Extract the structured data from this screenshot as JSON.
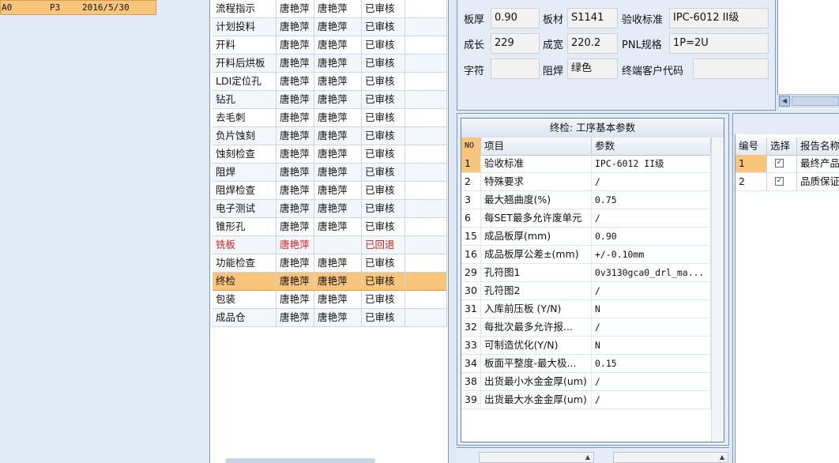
{
  "left_row": {
    "col0": "A0",
    "col1": "P3",
    "col2": "2016/5/30"
  },
  "process_rows": [
    {
      "name": "流程指示",
      "a": "唐艳萍",
      "b": "唐艳萍",
      "status": "已审核"
    },
    {
      "name": "计划投料",
      "a": "唐艳萍",
      "b": "唐艳萍",
      "status": "已审核"
    },
    {
      "name": "开料",
      "a": "唐艳萍",
      "b": "唐艳萍",
      "status": "已审核"
    },
    {
      "name": "开料后烘板",
      "a": "唐艳萍",
      "b": "唐艳萍",
      "status": "已审核"
    },
    {
      "name": "LDI定位孔",
      "a": "唐艳萍",
      "b": "唐艳萍",
      "status": "已审核"
    },
    {
      "name": "钻孔",
      "a": "唐艳萍",
      "b": "唐艳萍",
      "status": "已审核"
    },
    {
      "name": "去毛刺",
      "a": "唐艳萍",
      "b": "唐艳萍",
      "status": "已审核"
    },
    {
      "name": "负片蚀刻",
      "a": "唐艳萍",
      "b": "唐艳萍",
      "status": "已审核"
    },
    {
      "name": "蚀刻检查",
      "a": "唐艳萍",
      "b": "唐艳萍",
      "status": "已审核"
    },
    {
      "name": "阻焊",
      "a": "唐艳萍",
      "b": "唐艳萍",
      "status": "已审核"
    },
    {
      "name": "阻焊检查",
      "a": "唐艳萍",
      "b": "唐艳萍",
      "status": "已审核"
    },
    {
      "name": "电子测试",
      "a": "唐艳萍",
      "b": "唐艳萍",
      "status": "已审核"
    },
    {
      "name": "锥形孔",
      "a": "唐艳萍",
      "b": "唐艳萍",
      "status": "已审核"
    },
    {
      "name": "铣板",
      "a": "唐艳萍",
      "b": "",
      "status": "已回退",
      "highlight": "red"
    },
    {
      "name": "功能检查",
      "a": "唐艳萍",
      "b": "唐艳萍",
      "status": "已审核"
    },
    {
      "name": "终检",
      "a": "唐艳萍",
      "b": "唐艳萍",
      "status": "已审核",
      "selected": true
    },
    {
      "name": "包装",
      "a": "唐艳萍",
      "b": "唐艳萍",
      "status": "已审核"
    },
    {
      "name": "成品仓",
      "a": "唐艳萍",
      "b": "唐艳萍",
      "status": "已审核"
    }
  ],
  "info": {
    "thickness_label": "板厚",
    "thickness_value": "0.90",
    "material_label": "板材",
    "material_value": "S1141",
    "standard_label": "验收标准",
    "standard_value": "IPC-6012 II级",
    "length_label": "成长",
    "length_value": "229",
    "width_label": "成宽",
    "width_value": "220.2",
    "pnl_label": "PNL规格",
    "pnl_value": "1P=2U",
    "char_label": "字符",
    "char_value": "",
    "mask_label": "阻焊",
    "mask_value": "绿色",
    "customer_label": "终端客户代码",
    "customer_value": ""
  },
  "param_panel": {
    "title": "终检: 工序基本参数",
    "headers": {
      "no": "NO",
      "item": "项目",
      "param": "参数"
    },
    "rows": [
      {
        "no": "1",
        "item": "验收标准",
        "param": "IPC-6012 II级",
        "selected": true
      },
      {
        "no": "2",
        "item": "特殊要求",
        "param": "/"
      },
      {
        "no": "3",
        "item": "最大翘曲度(%)",
        "param": "0.75"
      },
      {
        "no": "6",
        "item": "每SET最多允许废单元",
        "param": "/"
      },
      {
        "no": "15",
        "item": "成品板厚(mm)",
        "param": "0.90"
      },
      {
        "no": "16",
        "item": "成品板厚公差±(mm)",
        "param": "+/-0.10mm"
      },
      {
        "no": "29",
        "item": "孔符图1",
        "param": "0v3130gca0_drl_ma..."
      },
      {
        "no": "30",
        "item": "孔符图2",
        "param": "/"
      },
      {
        "no": "31",
        "item": "入库前压板 (Y/N)",
        "param": "N"
      },
      {
        "no": "32",
        "item": "每批次最多允许报...",
        "param": "/"
      },
      {
        "no": "33",
        "item": "可制造优化(Y/N)",
        "param": "N"
      },
      {
        "no": "34",
        "item": "板面平整度-最大极...",
        "param": "0.15"
      },
      {
        "no": "38",
        "item": "出货最小水金金厚(um)",
        "param": "/"
      },
      {
        "no": "39",
        "item": "出货最大水金金厚(um)",
        "param": "/"
      }
    ]
  },
  "report_panel": {
    "headers": {
      "no": "编号",
      "select": "选择",
      "name": "报告名称"
    },
    "rows": [
      {
        "no": "1",
        "checked": "✓",
        "name": "最终产品",
        "selected": true
      },
      {
        "no": "2",
        "checked": "✓",
        "name": "品质保证"
      }
    ]
  },
  "icons": {
    "scroll_left": "◀",
    "scroll_up": "▲"
  }
}
